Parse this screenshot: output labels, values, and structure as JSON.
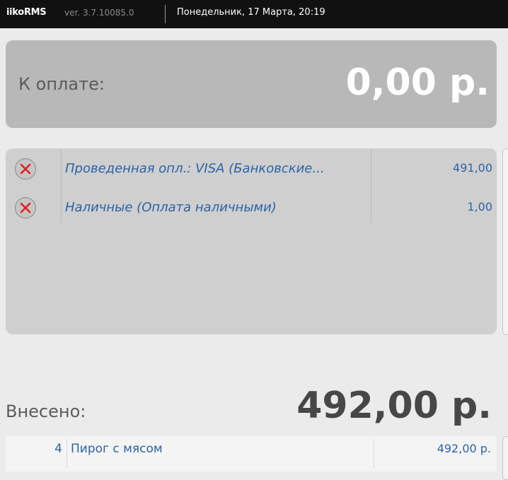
{
  "header": {
    "brand": "iikoRMS",
    "version": "ver. 3.7.10085.0",
    "datetime": "Понедельник, 17 Марта, 20:19"
  },
  "due": {
    "label": "К оплате:",
    "amount": "0,00 р."
  },
  "payments": [
    {
      "name": "Проведенная опл.: VISA (Банковские...",
      "amount": "491,00"
    },
    {
      "name": "Наличные (Оплата наличными)",
      "amount": "1,00"
    }
  ],
  "paid": {
    "label": "Внесено:",
    "amount": "492,00 р."
  },
  "order_items": [
    {
      "qty": "4",
      "name": "Пирог с мясом",
      "price": "492,00 р."
    }
  ],
  "colors": {
    "topbar": "#111111",
    "due_panel": "#b8b8b8",
    "payments_panel": "#cfcfcf",
    "link_blue": "#2a63a6",
    "remove_x": "#e02020"
  }
}
